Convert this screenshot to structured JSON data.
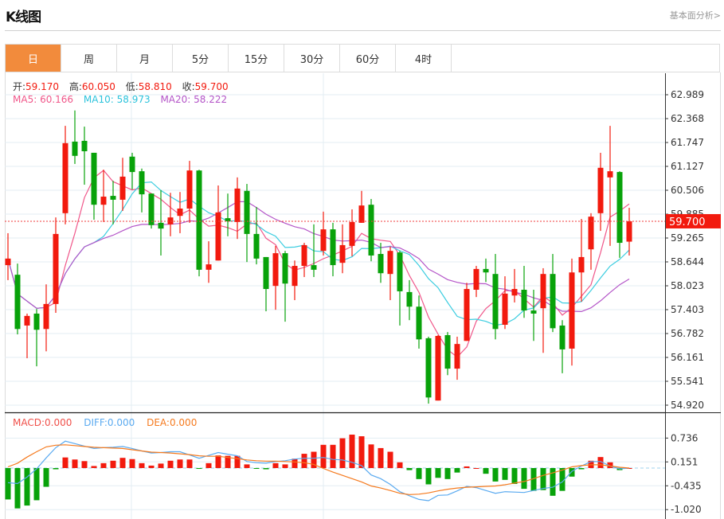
{
  "header": {
    "title": "K线图",
    "link": "基本面分析>"
  },
  "tabs": [
    {
      "label": "日",
      "active": true
    },
    {
      "label": "周"
    },
    {
      "label": "月"
    },
    {
      "label": "5分"
    },
    {
      "label": "15分"
    },
    {
      "label": "30分"
    },
    {
      "label": "60分"
    },
    {
      "label": "4时"
    }
  ],
  "ohlc_legend": {
    "open_label": "开:",
    "open": "59.170",
    "high_label": "高:",
    "high": "60.050",
    "low_label": "低:",
    "low": "58.810",
    "close_label": "收:",
    "close": "59.700"
  },
  "ma_legend": {
    "ma5_label": "MA5:",
    "ma5": "60.166",
    "ma10_label": "MA10:",
    "ma10": "58.973",
    "ma20_label": "MA20:",
    "ma20": "58.222"
  },
  "macd_legend": {
    "macd_label": "MACD:",
    "macd": "0.000",
    "diff_label": "DIFF:",
    "diff": "0.000",
    "dea_label": "DEA:",
    "dea": "0.000"
  },
  "colors": {
    "up": "#f21a0e",
    "down": "#08a20a",
    "ma5": "#f0578a",
    "ma10": "#3ccde0",
    "ma20": "#b455c8",
    "diff": "#5aaaf0",
    "dea": "#f57a1e",
    "active_tab": "#f28b3c"
  },
  "chart_data": [
    {
      "type": "candlestick",
      "current_price": "59.700",
      "y_ticks": [
        "62.989",
        "62.368",
        "61.747",
        "61.127",
        "60.506",
        "59.885",
        "59.265",
        "58.644",
        "58.023",
        "57.403",
        "56.782",
        "56.161",
        "55.541",
        "54.920"
      ],
      "ylim": [
        54.92,
        62.989
      ],
      "ma_periods": [
        5,
        10,
        20
      ],
      "candles": [
        [
          58.56,
          58.73,
          59.39,
          58.17
        ],
        [
          58.31,
          56.9,
          58.6,
          56.76
        ],
        [
          56.99,
          57.24,
          57.3,
          56.14
        ],
        [
          57.3,
          56.88,
          57.42,
          55.93
        ],
        [
          56.9,
          57.55,
          58.06,
          56.32
        ],
        [
          57.55,
          59.37,
          59.8,
          57.32
        ],
        [
          59.91,
          61.73,
          62.18,
          59.62
        ],
        [
          61.77,
          61.4,
          62.58,
          61.19
        ],
        [
          61.79,
          61.52,
          62.16,
          60.65
        ],
        [
          61.48,
          60.13,
          61.48,
          59.74
        ],
        [
          60.13,
          60.34,
          61.04,
          59.68
        ],
        [
          60.36,
          60.26,
          60.75,
          59.62
        ],
        [
          60.26,
          60.86,
          61.35,
          59.97
        ],
        [
          61.38,
          60.98,
          61.48,
          60.53
        ],
        [
          61.0,
          60.4,
          61.07,
          59.93
        ],
        [
          60.42,
          59.6,
          60.42,
          59.51
        ],
        [
          59.66,
          59.51,
          60.51,
          58.81
        ],
        [
          59.62,
          59.8,
          60.44,
          59.31
        ],
        [
          59.84,
          60.03,
          60.46,
          59.39
        ],
        [
          60.03,
          61.02,
          61.27,
          59.66
        ],
        [
          61.02,
          58.44,
          61.04,
          58.27
        ],
        [
          58.44,
          58.58,
          59.18,
          58.1
        ],
        [
          58.68,
          59.93,
          60.63,
          58.68
        ],
        [
          59.78,
          59.7,
          60.42,
          59.31
        ],
        [
          59.68,
          60.55,
          60.84,
          59.24
        ],
        [
          60.49,
          59.37,
          60.67,
          58.64
        ],
        [
          59.37,
          58.73,
          60.07,
          58.58
        ],
        [
          58.77,
          57.94,
          58.77,
          57.36
        ],
        [
          58.02,
          58.87,
          59.06,
          57.4
        ],
        [
          58.87,
          58.08,
          58.93,
          57.09
        ],
        [
          58.02,
          58.54,
          58.68,
          57.65
        ],
        [
          58.54,
          59.08,
          59.14,
          58.25
        ],
        [
          58.56,
          58.44,
          59.62,
          58.25
        ],
        [
          58.93,
          59.49,
          59.95,
          58.81
        ],
        [
          59.49,
          58.56,
          59.66,
          58.27
        ],
        [
          58.62,
          59.08,
          59.62,
          58.35
        ],
        [
          59.06,
          59.68,
          60.01,
          58.79
        ],
        [
          59.66,
          60.11,
          60.49,
          59.66
        ],
        [
          60.13,
          58.81,
          60.28,
          58.66
        ],
        [
          58.85,
          58.35,
          59.14,
          58.1
        ],
        [
          58.33,
          58.93,
          59.04,
          57.65
        ],
        [
          58.89,
          57.88,
          58.93,
          56.99
        ],
        [
          57.86,
          57.48,
          58.17,
          57.13
        ],
        [
          57.48,
          56.63,
          57.77,
          56.39
        ],
        [
          56.66,
          55.12,
          56.7,
          54.96
        ],
        [
          55.04,
          56.72,
          56.74,
          55.04
        ],
        [
          56.74,
          55.87,
          56.82,
          55.7
        ],
        [
          55.87,
          56.51,
          56.7,
          55.58
        ],
        [
          56.59,
          57.94,
          58.1,
          56.59
        ],
        [
          57.92,
          58.46,
          58.54,
          57.73
        ],
        [
          58.46,
          58.37,
          58.73,
          58.12
        ],
        [
          58.33,
          56.9,
          58.85,
          56.63
        ],
        [
          57.01,
          57.82,
          58.27,
          56.9
        ],
        [
          57.77,
          57.94,
          58.46,
          57.59
        ],
        [
          57.92,
          57.38,
          58.54,
          57.19
        ],
        [
          57.38,
          57.3,
          57.92,
          56.59
        ],
        [
          57.44,
          58.33,
          58.48,
          56.28
        ],
        [
          58.33,
          56.92,
          58.85,
          56.82
        ],
        [
          56.99,
          56.37,
          57.13,
          55.75
        ],
        [
          56.39,
          58.37,
          58.73,
          55.95
        ],
        [
          58.37,
          58.77,
          59.76,
          57.61
        ],
        [
          58.97,
          59.82,
          59.91,
          58.44
        ],
        [
          59.91,
          61.09,
          61.48,
          59.45
        ],
        [
          60.84,
          61.0,
          62.18,
          59.06
        ],
        [
          60.98,
          59.14,
          61.0,
          58.75
        ],
        [
          59.17,
          59.7,
          60.05,
          58.81
        ]
      ]
    },
    {
      "type": "bar+line",
      "y_ticks": [
        "0.736",
        "0.151",
        "-0.435",
        "-1.020"
      ],
      "macd": [
        -0.77,
        -0.99,
        -0.92,
        -0.79,
        -0.46,
        -0.03,
        0.26,
        0.21,
        0.17,
        0.05,
        0.12,
        0.18,
        0.25,
        0.22,
        0.12,
        0.06,
        0.11,
        0.18,
        0.21,
        0.21,
        -0.02,
        0.12,
        0.31,
        0.3,
        0.3,
        0.09,
        -0.01,
        -0.03,
        0.12,
        0.09,
        0.23,
        0.35,
        0.4,
        0.57,
        0.57,
        0.73,
        0.82,
        0.78,
        0.58,
        0.49,
        0.4,
        0.14,
        -0.05,
        -0.27,
        -0.4,
        -0.24,
        -0.27,
        -0.11,
        0.04,
        0,
        -0.14,
        -0.33,
        -0.29,
        -0.39,
        -0.51,
        -0.56,
        -0.54,
        -0.68,
        -0.56,
        -0.21,
        -0.03,
        0.18,
        0.27,
        0.14,
        -0.05,
        0
      ],
      "diff": [
        -0.36,
        -0.38,
        -0.22,
        -0.02,
        0.25,
        0.5,
        0.66,
        0.6,
        0.54,
        0.48,
        0.5,
        0.51,
        0.53,
        0.48,
        0.42,
        0.37,
        0.38,
        0.4,
        0.4,
        0.32,
        0.24,
        0.31,
        0.38,
        0.34,
        0.3,
        0.16,
        0.13,
        0.12,
        0.16,
        0.18,
        0.22,
        0.24,
        0.24,
        0.26,
        0.21,
        0.2,
        0.14,
        0.06,
        -0.17,
        -0.26,
        -0.4,
        -0.58,
        -0.68,
        -0.77,
        -0.8,
        -0.67,
        -0.66,
        -0.56,
        -0.45,
        -0.48,
        -0.55,
        -0.62,
        -0.58,
        -0.59,
        -0.6,
        -0.55,
        -0.5,
        -0.47,
        -0.34,
        -0.08,
        0.05,
        0.16,
        0.16,
        0.05,
        -0.02,
        0.0
      ],
      "dea": [
        0.03,
        0.12,
        0.27,
        0.4,
        0.52,
        0.56,
        0.57,
        0.55,
        0.53,
        0.51,
        0.5,
        0.49,
        0.48,
        0.45,
        0.42,
        0.39,
        0.38,
        0.37,
        0.35,
        0.33,
        0.3,
        0.29,
        0.29,
        0.26,
        0.23,
        0.2,
        0.18,
        0.17,
        0.17,
        0.16,
        0.15,
        0.13,
        0.09,
        -0.01,
        -0.1,
        -0.18,
        -0.26,
        -0.34,
        -0.44,
        -0.49,
        -0.55,
        -0.62,
        -0.65,
        -0.64,
        -0.61,
        -0.56,
        -0.52,
        -0.49,
        -0.47,
        -0.46,
        -0.45,
        -0.44,
        -0.41,
        -0.37,
        -0.33,
        -0.26,
        -0.18,
        -0.12,
        -0.05,
        0.03,
        0.06,
        0.08,
        0.08,
        0.05,
        0.02,
        0.0
      ]
    }
  ]
}
